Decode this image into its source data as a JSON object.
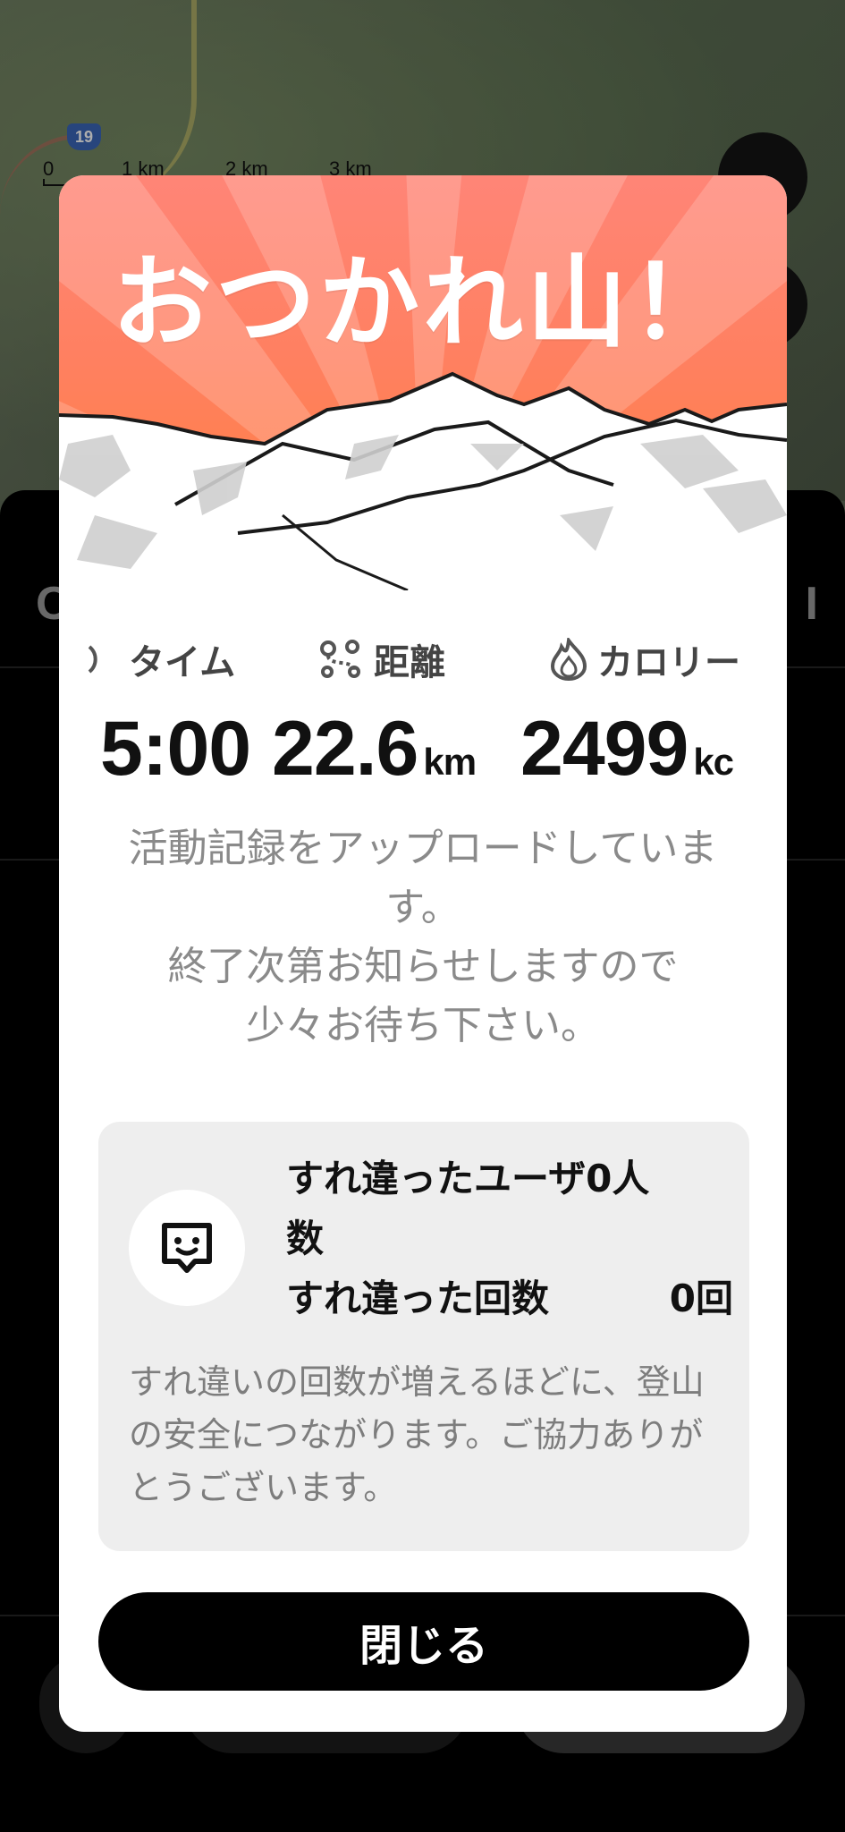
{
  "map": {
    "route_number": "19",
    "scale_labels": [
      "0",
      "1 km",
      "2 km",
      "3 km"
    ]
  },
  "modal": {
    "title": "おつかれ山！",
    "stats": [
      {
        "label": "タイム",
        "value": "5:00",
        "unit": "",
        "icon": "clock-icon"
      },
      {
        "label": "距離",
        "value": "22.6",
        "unit": "km",
        "icon": "route-icon"
      },
      {
        "label": "カロリー",
        "value": "2499",
        "unit": "kc",
        "icon": "flame-icon"
      }
    ],
    "upload_message": "活動記録をアップロードしています。\n終了次第お知らせしますので\n少々お待ち下さい。",
    "passing": {
      "icon": "passing-chat-icon",
      "users_label": "すれ違ったユーザ数",
      "users_value": "0人",
      "count_label": "すれ違った回数",
      "count_value": "0回",
      "note": "すれ違いの回数が増えるほどに、登山の安全につながります。ご協力ありがとうございます。"
    },
    "close_label": "閉じる"
  },
  "colors": {
    "hero_top": "#ff8577",
    "hero_bottom": "#ff7f3c",
    "button": "#000000",
    "box": "#eeeeee"
  }
}
